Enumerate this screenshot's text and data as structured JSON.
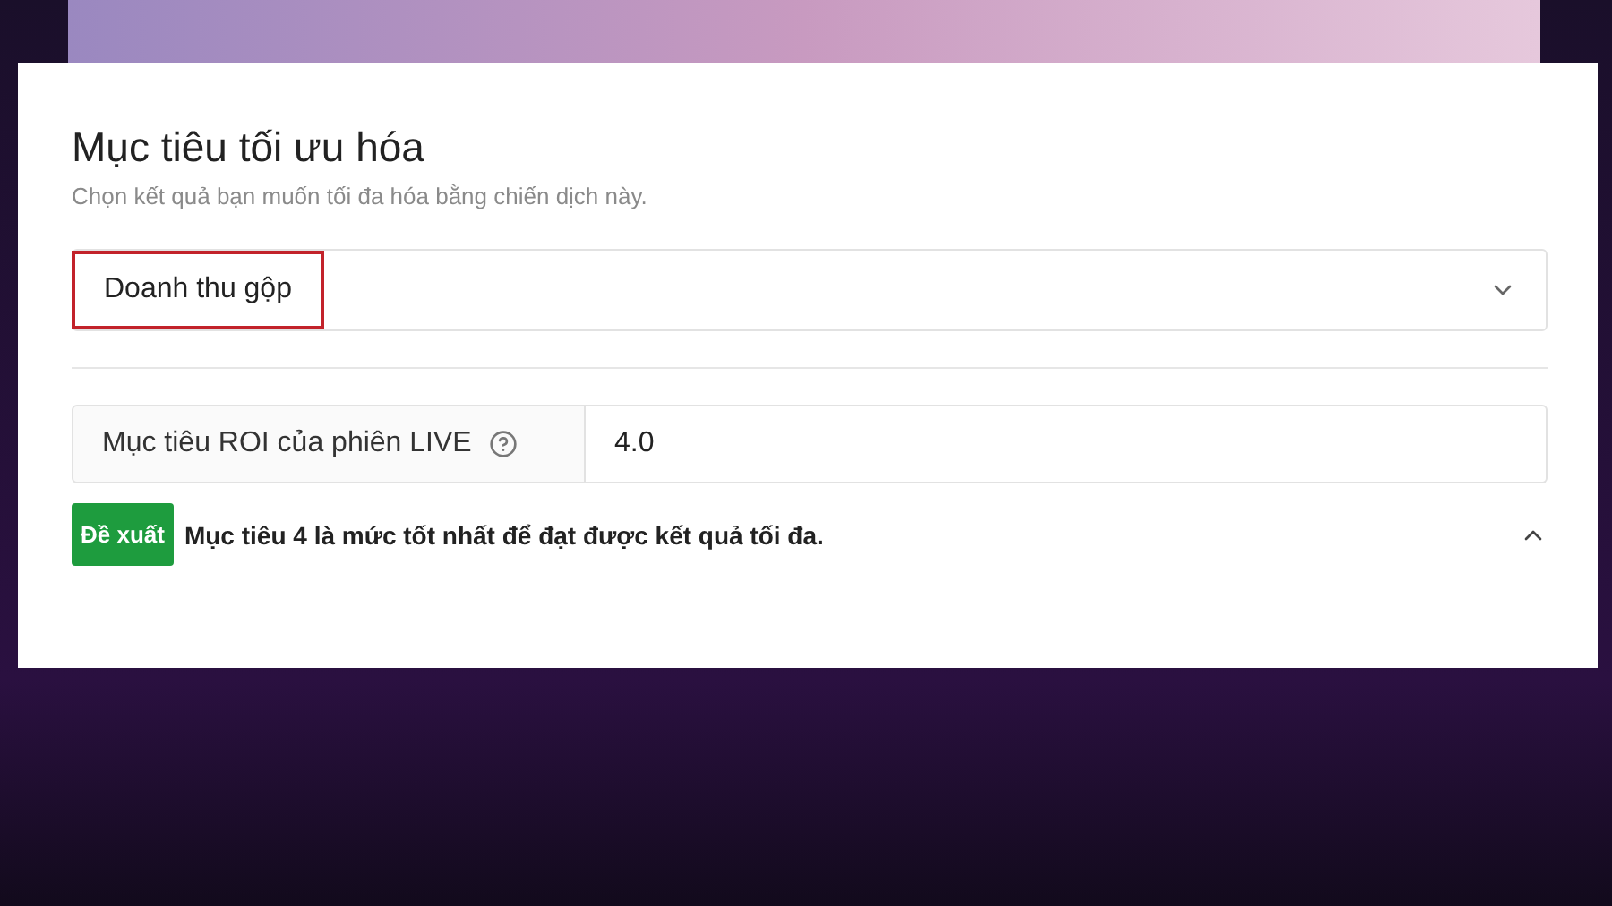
{
  "card": {
    "title": "Mục tiêu tối ưu hóa",
    "subtitle": "Chọn kết quả bạn muốn tối đa hóa bằng chiến dịch này.",
    "dropdown": {
      "value": "Doanh thu gộp",
      "highlighted": true,
      "expanded": false
    },
    "roi_field": {
      "label": "Mục tiêu ROI của phiên LIVE",
      "value": "4.0"
    },
    "suggestion": {
      "badge": "Đề xuất",
      "text": "Mục tiêu 4 là mức tốt nhất để đạt được kết quả tối đa.",
      "expanded": true
    }
  }
}
